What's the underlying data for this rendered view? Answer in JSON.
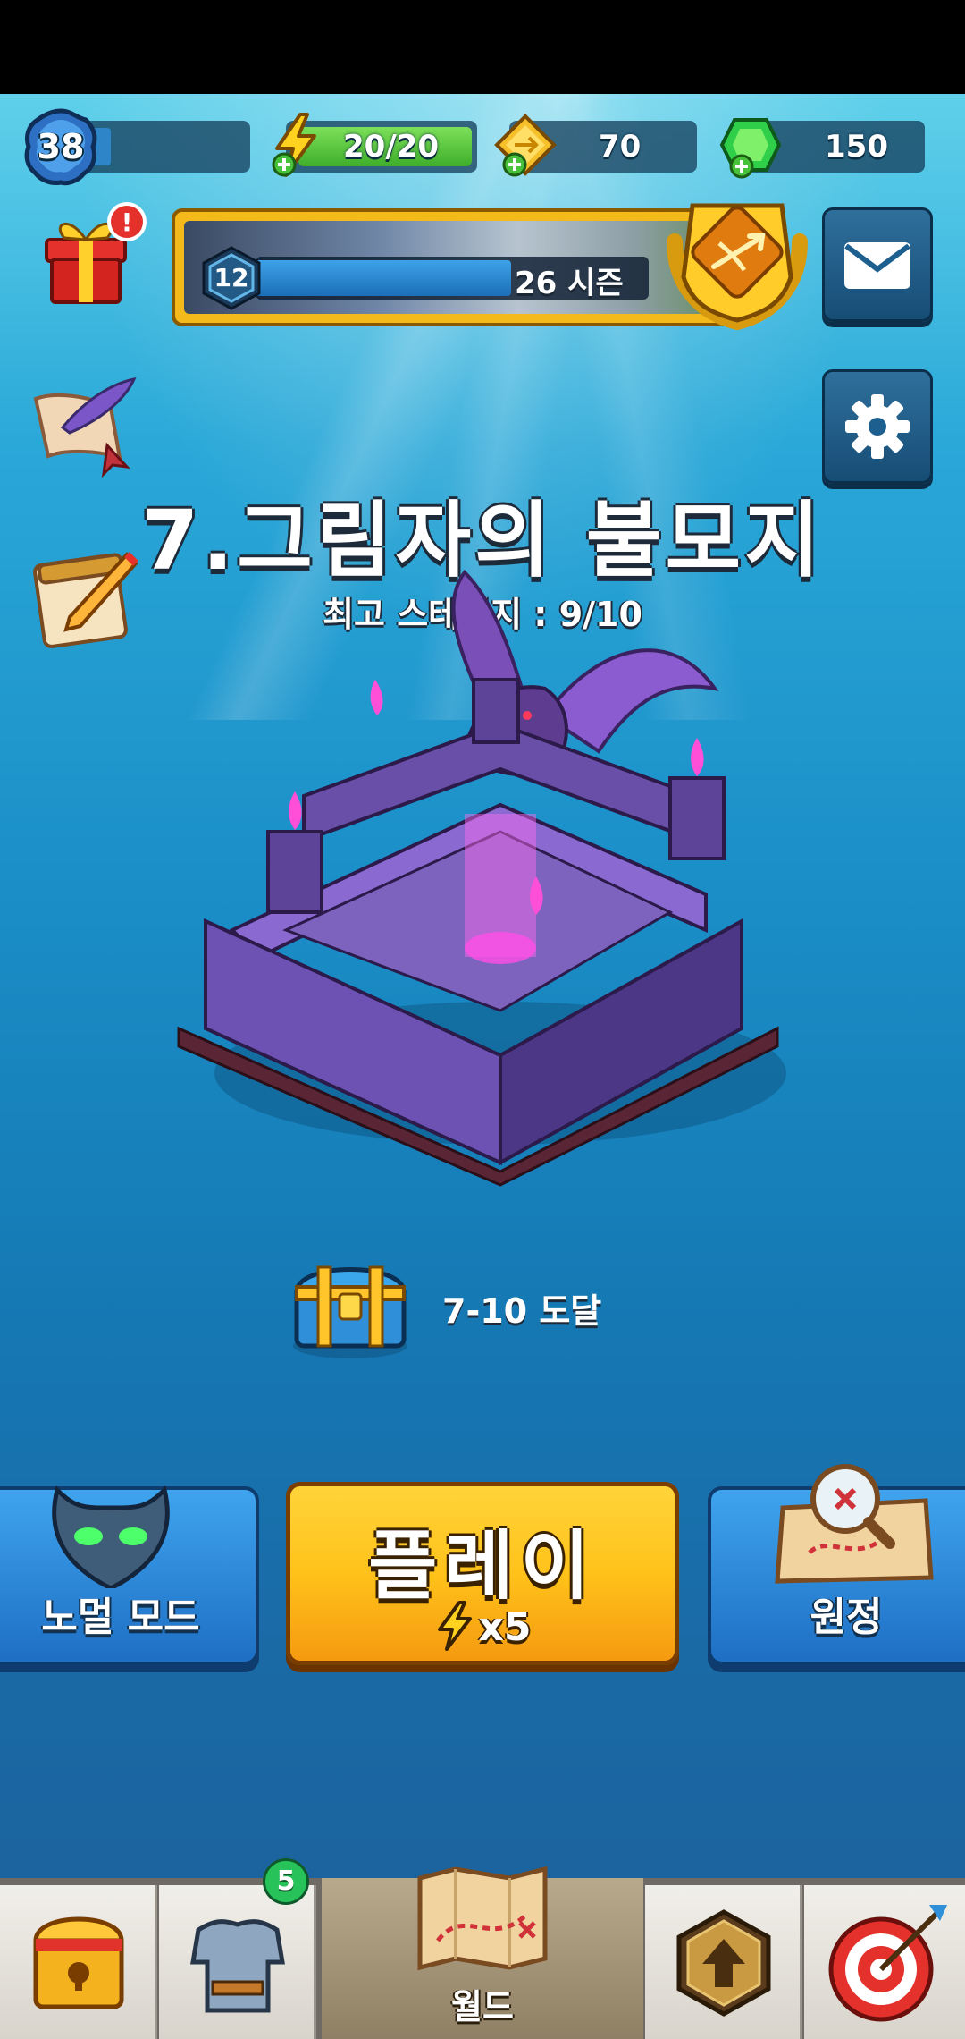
{
  "player": {
    "level": "38"
  },
  "resources": {
    "energy": "20/20",
    "gold": "70",
    "gems": "150"
  },
  "season": {
    "level": "12",
    "label": "26 시즌",
    "progress": 0.65
  },
  "stage": {
    "title": "7.그림자의 불모지",
    "best": "최고 스테이지 : 9/10"
  },
  "reward": {
    "label": "7-10 도달"
  },
  "modes": {
    "normal_label": "노멀 모드",
    "play_label": "플레이",
    "play_cost": "x5",
    "expedition_label": "원정"
  },
  "nav": {
    "equipment_badge": "5",
    "world_label": "월드"
  },
  "colors": {
    "play_button": "#ffc21a",
    "mode_button": "#2f8bdc",
    "energy_bar": "#4fc232"
  }
}
